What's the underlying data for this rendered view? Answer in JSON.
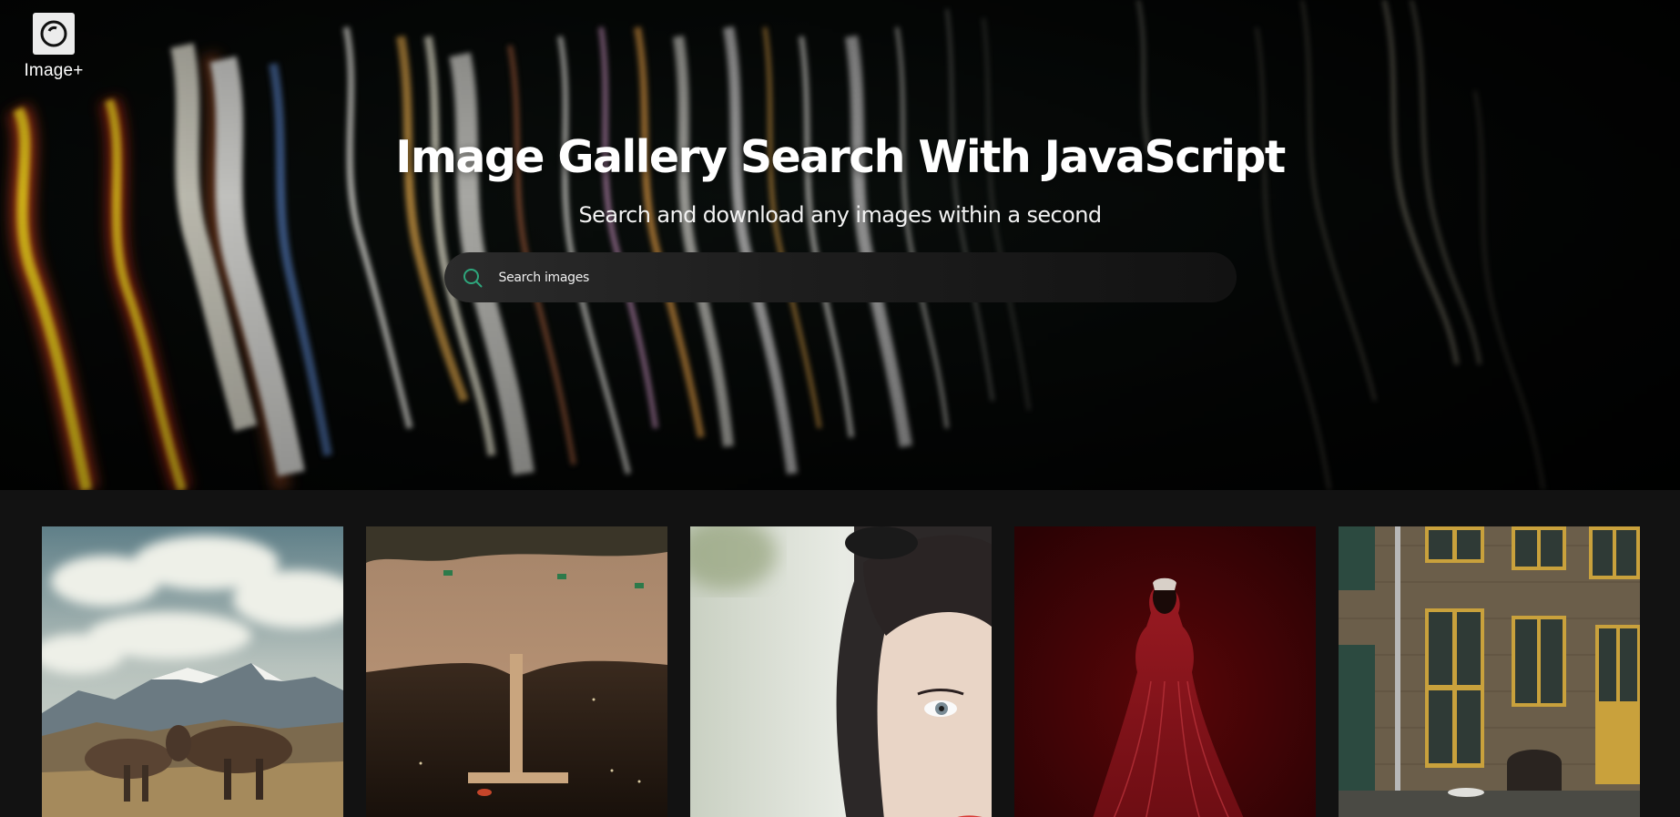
{
  "brand": {
    "name": "Image+",
    "icon": "eye-logo-icon"
  },
  "hero": {
    "title": "Image Gallery Search With JavaScript",
    "subtitle": "Search and download any images within a second"
  },
  "search": {
    "placeholder": "Search images",
    "value": "",
    "icon": "search-icon",
    "accent": "#2ea67c"
  },
  "gallery": {
    "cards": [
      {
        "subject": "donkeys-mountain-photo"
      },
      {
        "subject": "aerial-beach-pier-photo"
      },
      {
        "subject": "woman-portrait-photo"
      },
      {
        "subject": "red-dress-figure-photo"
      },
      {
        "subject": "brick-building-facade-photo"
      }
    ]
  }
}
